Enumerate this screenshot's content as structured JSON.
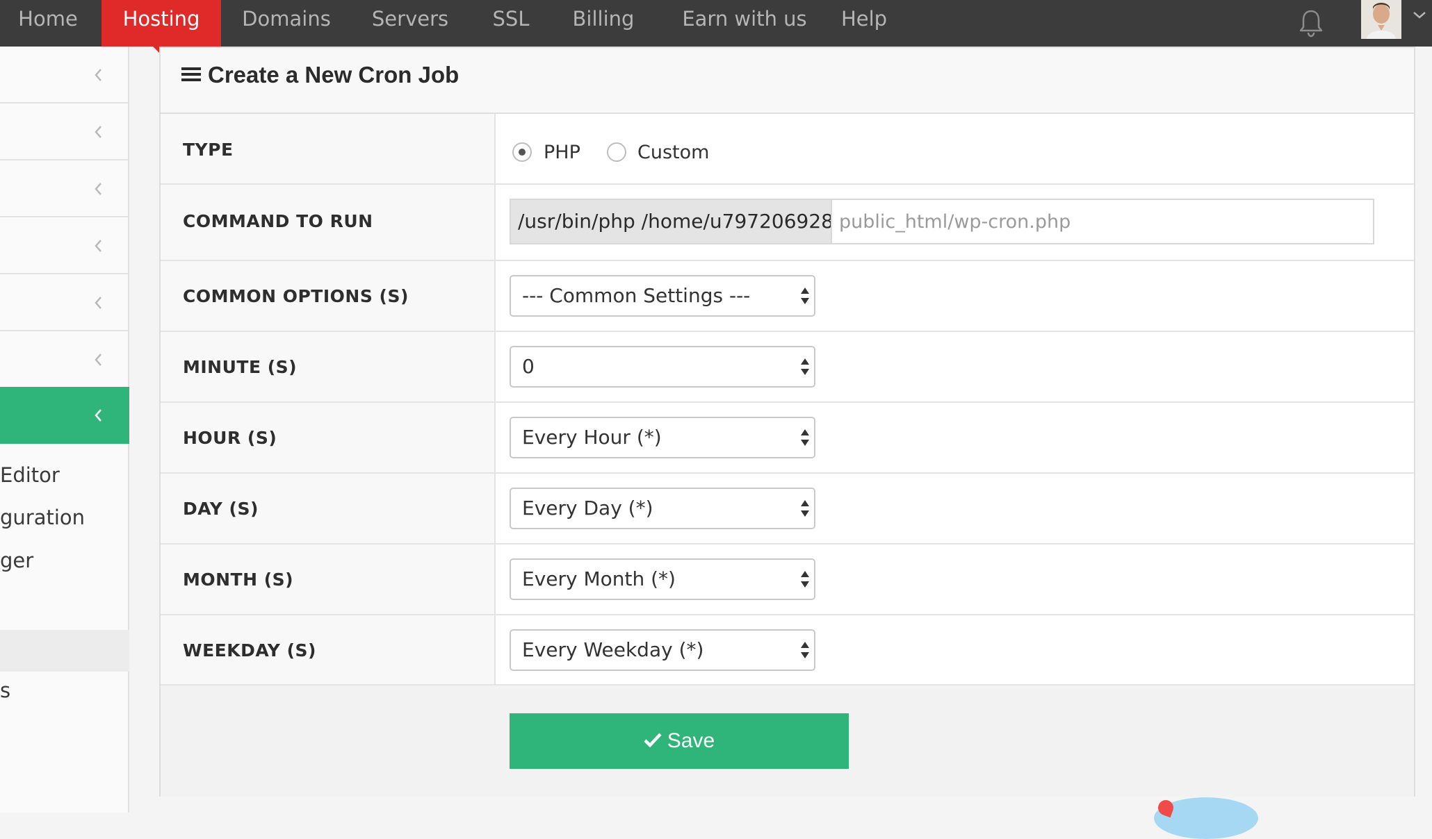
{
  "nav": {
    "items": [
      "Home",
      "Hosting",
      "Domains",
      "Servers",
      "SSL",
      "Billing",
      "Earn with us",
      "Help"
    ],
    "active": "Hosting"
  },
  "sidebar": {
    "fragments": [
      "Editor",
      "guration",
      "ger",
      "s"
    ]
  },
  "panel": {
    "title": "Create a New Cron Job"
  },
  "form": {
    "type_label": "TYPE",
    "type_options": [
      "PHP",
      "Custom"
    ],
    "type_selected": "PHP",
    "command_label": "COMMAND TO RUN",
    "command_prefix": "/usr/bin/php /home/u797206928/",
    "command_placeholder": "public_html/wp-cron.php",
    "common_label": "COMMON OPTIONS (S)",
    "common_value": "--- Common Settings ---",
    "minute_label": "MINUTE (S)",
    "minute_value": "0",
    "hour_label": "HOUR (S)",
    "hour_value": "Every Hour (*)",
    "day_label": "DAY (S)",
    "day_value": "Every Day (*)",
    "month_label": "MONTH (S)",
    "month_value": "Every Month (*)",
    "weekday_label": "WEEKDAY (S)",
    "weekday_value": "Every Weekday (*)",
    "save_label": "Save"
  },
  "colors": {
    "nav_bg": "#3c3c3c",
    "active_red": "#e02a2a",
    "accent_green": "#2fb57a"
  },
  "icons": [
    "bell-icon",
    "avatar",
    "chevron-down-icon",
    "chevron-left-icon",
    "hamburger-icon",
    "check-icon",
    "select-arrows-icon"
  ]
}
